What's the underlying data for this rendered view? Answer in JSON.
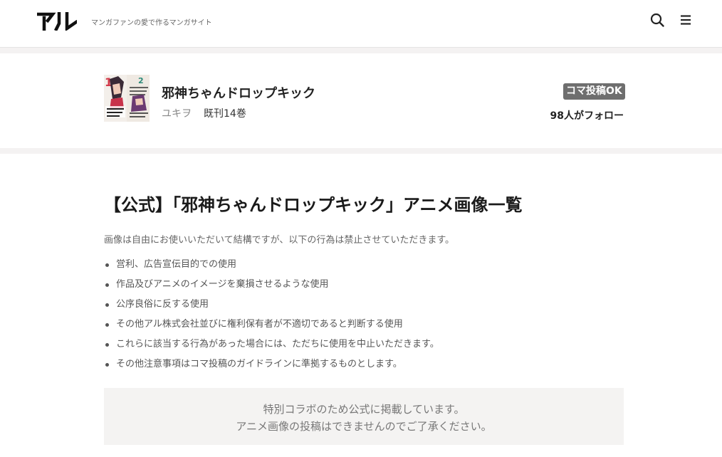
{
  "header": {
    "logo_text": "アル",
    "tagline": "マンガファンの愛で作るマンガサイト",
    "search_icon": "search-icon",
    "menu_icon": "menu-icon"
  },
  "manga": {
    "title": "邪神ちゃんドロップキック",
    "author": "ユキヲ",
    "volumes": "既刊14巻",
    "badge": "コマ投稿OK",
    "followers": "98人がフォロー"
  },
  "article": {
    "title": "【公式】「邪神ちゃんドロップキック」アニメ画像一覧",
    "intro": "画像は自由にお使いいただいて結構ですが、以下の行為は禁止させていただきます。",
    "rules": [
      "営利、広告宣伝目的での使用",
      "作品及びアニメのイメージを棄損させるような使用",
      "公序良俗に反する使用",
      "その他アル株式会社並びに権利保有者が不適切であると判断する使用",
      "これらに該当する行為があった場合には、ただちに使用を中止いただきます。",
      "その他注意事項はコマ投稿のガイドラインに準拠するものとします。"
    ],
    "notice": [
      "特別コラボのため公式に掲載しています。",
      "アニメ画像の投稿はできませんのでご了承ください。"
    ]
  },
  "colors": {
    "badge_bg": "#6e6e6e",
    "band": "#f4f2f2",
    "notice_bg": "#f4f3f2"
  }
}
